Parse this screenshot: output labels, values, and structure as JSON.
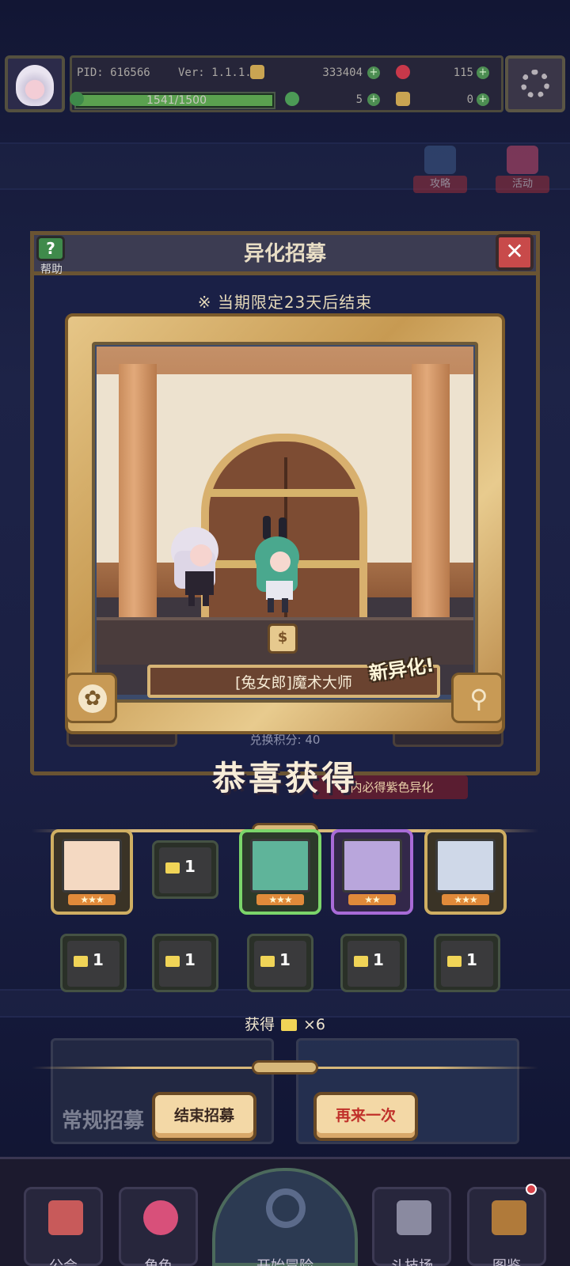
{
  "topbar": {
    "pid": "PID: 616566",
    "version": "Ver: 1.1.1.4",
    "gold": "333404",
    "gems": "115",
    "clover": "5",
    "keys": "0",
    "xp_text": "1541/1500",
    "xp_fraction": 1.0
  },
  "side_buttons": {
    "guide": "攻略",
    "event": "活动"
  },
  "dialog": {
    "title": "异化招募",
    "help_label": "帮助",
    "limited_text": "※ 当期限定23天后结束",
    "exchange_score": "兑换积分: 40",
    "pity_text": "内必得紫色异化"
  },
  "reward": {
    "character_name": "[兔女郎]魔术大师",
    "new_tag": "新异化!",
    "emblem_icon": "coin-emblem-icon"
  },
  "congrats": "恭喜获得",
  "cards": [
    {
      "rarity": "gold",
      "stars": "★★★",
      "portrait": "#f4d9c2"
    },
    {
      "rarity": "gray",
      "count": "1"
    },
    {
      "rarity": "green",
      "stars": "★★★",
      "portrait": "#5fb49a"
    },
    {
      "rarity": "purple",
      "stars": "★★",
      "portrait": "#b9a6dc"
    },
    {
      "rarity": "gold",
      "stars": "★★★",
      "portrait": "#cfd8e8"
    }
  ],
  "materials": [
    "1",
    "1",
    "1",
    "1",
    "1"
  ],
  "obtain": {
    "prefix": "获得",
    "suffix": "×6"
  },
  "background": {
    "normal_recruit": "常规招募"
  },
  "actions": {
    "end": "结束招募",
    "again": "再来一次"
  },
  "nav": {
    "guild": "公会",
    "character": "角色",
    "adventure": "开始冒险",
    "arena": "斗技场",
    "codex": "图鉴"
  },
  "colors": {
    "accent_gold": "#d8b87a",
    "again_text": "#c0302a",
    "xp_green": "#5aa14f"
  }
}
